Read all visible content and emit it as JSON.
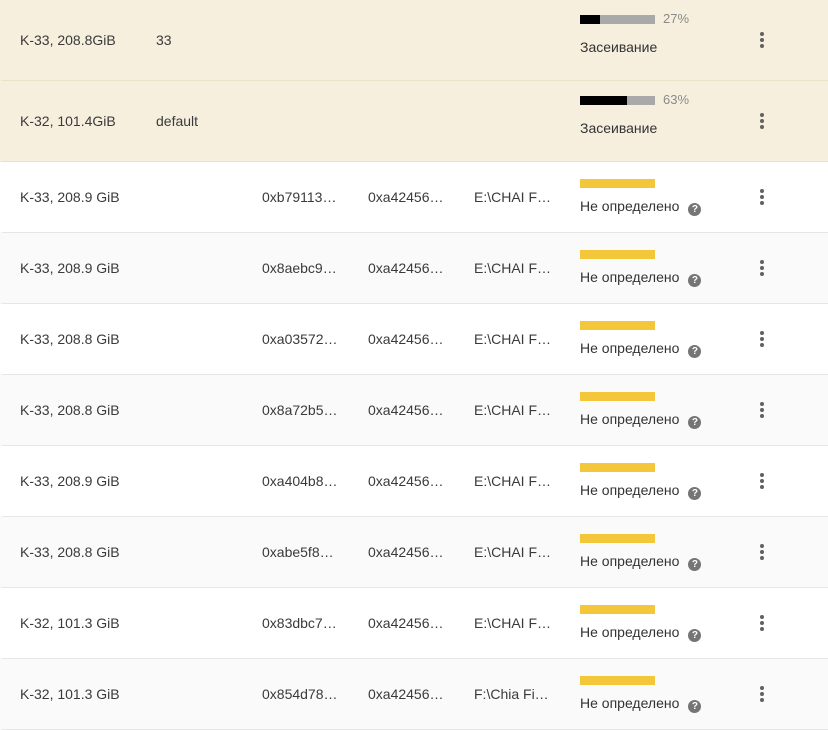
{
  "icons": {
    "menu": "more-vert-icon",
    "help": "help-circle-icon"
  },
  "colors": {
    "plotting_row_bg": "#f6efde",
    "progress_fill": "#000000",
    "progress_track": "#a9a9a9",
    "unknown_bar": "#f4c63a"
  },
  "plotting": [
    {
      "size": "K-33, 208.8GiB",
      "queue": "33",
      "progress": 27,
      "progress_label": "27%",
      "status": "Засеивание"
    },
    {
      "size": "K-32, 101.4GiB",
      "queue": "default",
      "progress": 63,
      "progress_label": "63%",
      "status": "Засеивание"
    }
  ],
  "plots": [
    {
      "size": "K-33, 208.9 GiB",
      "farmer_key": "0xb79113…",
      "pool_key": "0xa42456…",
      "path": "E:\\CHAI F…",
      "status": "Не определено",
      "help": "?"
    },
    {
      "size": "K-33, 208.9 GiB",
      "farmer_key": "0x8aebc9…",
      "pool_key": "0xa42456…",
      "path": "E:\\CHAI F…",
      "status": "Не определено",
      "help": "?"
    },
    {
      "size": "K-33, 208.8 GiB",
      "farmer_key": "0xa03572…",
      "pool_key": "0xa42456…",
      "path": "E:\\CHAI F…",
      "status": "Не определено",
      "help": "?"
    },
    {
      "size": "K-33, 208.8 GiB",
      "farmer_key": "0x8a72b5…",
      "pool_key": "0xa42456…",
      "path": "E:\\CHAI F…",
      "status": "Не определено",
      "help": "?"
    },
    {
      "size": "K-33, 208.9 GiB",
      "farmer_key": "0xa404b8…",
      "pool_key": "0xa42456…",
      "path": "E:\\CHAI F…",
      "status": "Не определено",
      "help": "?"
    },
    {
      "size": "K-33, 208.8 GiB",
      "farmer_key": "0xabe5f8…",
      "pool_key": "0xa42456…",
      "path": "E:\\CHAI F…",
      "status": "Не определено",
      "help": "?"
    },
    {
      "size": "K-32, 101.3 GiB",
      "farmer_key": "0x83dbc7…",
      "pool_key": "0xa42456…",
      "path": "E:\\CHAI F…",
      "status": "Не определено",
      "help": "?"
    },
    {
      "size": "K-32, 101.3 GiB",
      "farmer_key": "0x854d78…",
      "pool_key": "0xa42456…",
      "path": "F:\\Chia Fi…",
      "status": "Не определено",
      "help": "?"
    }
  ]
}
